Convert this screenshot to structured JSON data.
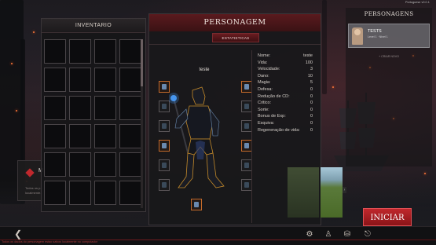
{
  "version_label": "Portuguese v0.0.1",
  "inventory": {
    "title": "INVENTARIO",
    "slot_count": 24
  },
  "popup": {
    "title": "M",
    "text": "Todos os p... localmente..."
  },
  "character": {
    "title": "PERSONAGEM",
    "tab_label": "ESTATISTICAS",
    "name": "teste",
    "stats": [
      {
        "label": "Nome:",
        "value": "teste"
      },
      {
        "label": "Vida:",
        "value": "100"
      },
      {
        "label": "Velocidade:",
        "value": "3"
      },
      {
        "label": "Dano:",
        "value": "10"
      },
      {
        "label": "Magia:",
        "value": "5"
      },
      {
        "label": "Defesa:",
        "value": "0"
      },
      {
        "label": "Redução de CD:",
        "value": "0"
      },
      {
        "label": "Critico:",
        "value": "0"
      },
      {
        "label": "Sorte:",
        "value": "0"
      },
      {
        "label": "Bonus de Exp:",
        "value": "0"
      },
      {
        "label": "Esquiva:",
        "value": "0"
      },
      {
        "label": "Regeneração de vida:",
        "value": "0"
      }
    ]
  },
  "characters_panel": {
    "title": "PERSONAGENS",
    "selected": {
      "name": "TESTS",
      "subtitle": "Level 1 · Nivel 1"
    },
    "new_label": "+ CRIAR NOVO"
  },
  "play_button": "INICIAR",
  "footer": {
    "text": "Todos os dados do personagem estao salvos localmente no computador"
  },
  "colors": {
    "accent": "#c0282d",
    "slot_highlight": "#c46a2a",
    "panel_bg": "#18181a"
  }
}
